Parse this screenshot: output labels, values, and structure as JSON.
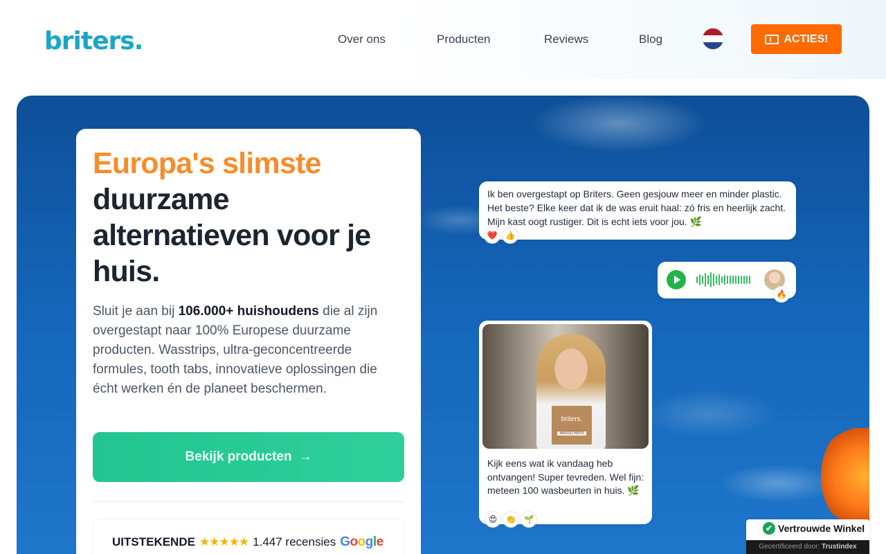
{
  "header": {
    "logo": "briters.",
    "nav": [
      {
        "label": "Over ons"
      },
      {
        "label": "Producten"
      },
      {
        "label": "Reviews"
      },
      {
        "label": "Blog"
      }
    ],
    "language": "NL",
    "acties_label": "ACTIES!"
  },
  "hero": {
    "headline_accent": "Europa's slimste",
    "headline_rest": "duurzame alternatieven voor je huis.",
    "intro_before": "Sluit je aan bij ",
    "intro_bold": "106.000+ huishoudens",
    "intro_after": " die al zijn overgestapt naar 100% Europese duurzame producten. Wasstrips, ultra-geconcentreerde formules, tooth tabs, innovatieve oplossingen die écht werken én de planeet beschermen.",
    "cta_label": "Bekijk producten",
    "cta_arrow": "→",
    "rating": {
      "label": "UITSTEKENDE",
      "stars": "★★★★★",
      "stars_value": 4.5,
      "count": "1.447 recensies",
      "brand": [
        "G",
        "o",
        "o",
        "g",
        "l",
        "e"
      ]
    }
  },
  "chat": {
    "message1": "Ik ben overgestapt op Briters. Geen gesjouw meer en minder plastic. Het beste? Elke keer dat ik de was eruit haal: zó fris en heerlijk zacht. Mijn kast oogt rustiger. Dit is echt iets voor jou. 🌿",
    "message1_reactions": [
      "❤️",
      "👍"
    ],
    "voice_reaction": "🔥",
    "video_package_brand": "briters.",
    "video_package_label": "WASSTRIPS",
    "message3": "Kijk eens wat ik vandaag heb ontvangen! Super tevreden. Wel fijn: meteen 100 wasbeurten in huis. 🌿",
    "message3_reactions": [
      "😍",
      "👏",
      "🌱"
    ]
  },
  "trust_badge": {
    "title": "Vertrouwde Winkel",
    "certified_prefix": "Gecertificeerd door:",
    "certified_by": "Trustindex"
  },
  "colors": {
    "brand": "#1aa6c6",
    "accent": "#f78c2a",
    "acties": "#ff6a00",
    "cta": "#22c58f",
    "sky": "#1566ba"
  }
}
